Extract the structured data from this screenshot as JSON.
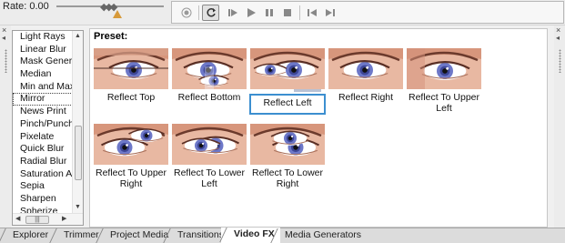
{
  "rate": {
    "label": "Rate: 0.00"
  },
  "grip_left": {
    "close": "×",
    "arrow": "◂"
  },
  "grip_right": {
    "close": "×",
    "arrow": "◂"
  },
  "effects_list": {
    "items": [
      "Light Rays",
      "Linear Blur",
      "Mask Generato",
      "Median",
      "Min and Max",
      "Mirror",
      "News Print",
      "Pinch/Punch",
      "Pixelate",
      "Quick Blur",
      "Radial Blur",
      "Saturation Adj",
      "Sepia",
      "Sharpen",
      "Spherize"
    ],
    "selected_index": 5
  },
  "preset": {
    "title": "Preset:",
    "tiles": [
      {
        "label": "Reflect Top",
        "variant": "top"
      },
      {
        "label": "Reflect Bottom",
        "variant": "bottom"
      },
      {
        "label": "Reflect Left",
        "variant": "left",
        "selected": true
      },
      {
        "label": "Reflect Right",
        "variant": "right"
      },
      {
        "label": "Reflect To Upper Left",
        "variant": "upper-left"
      },
      {
        "label": "Reflect To Upper Right",
        "variant": "upper-right"
      },
      {
        "label": "Reflect To Lower Left",
        "variant": "lower-left"
      },
      {
        "label": "Reflect To Lower Right",
        "variant": "lower-right"
      }
    ]
  },
  "tabs": [
    {
      "label": "Explorer"
    },
    {
      "label": "Trimmer"
    },
    {
      "label": "Project Media"
    },
    {
      "label": "Transitions"
    },
    {
      "label": "Video FX",
      "active": true
    },
    {
      "label": "Media Generators"
    }
  ],
  "colors": {
    "selection_border": "#3c8fd0",
    "rate_marker": "#d79a3a",
    "iris": "#6d78c8"
  }
}
